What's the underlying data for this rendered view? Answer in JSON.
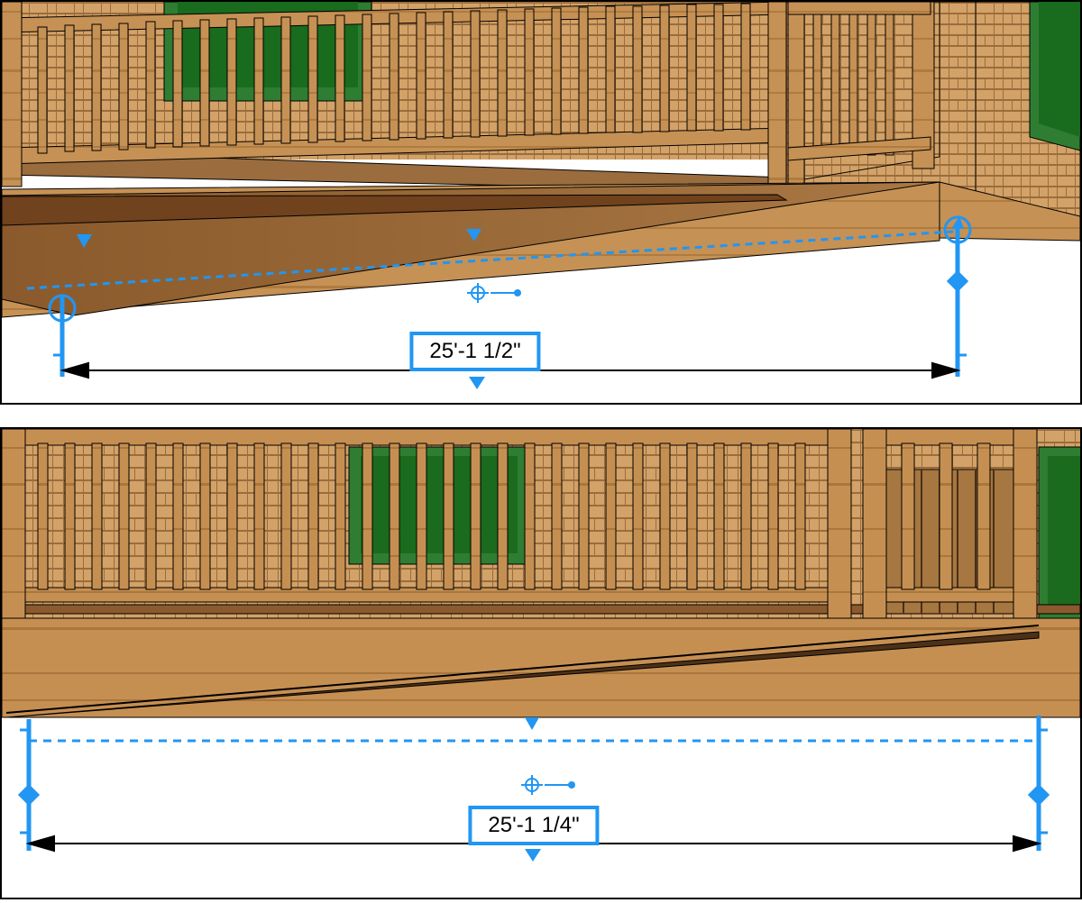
{
  "panels": [
    {
      "id": "top",
      "dimension_text": "25'-1 1/2\"",
      "dimension_label_x": 525,
      "dimension_label_y": 388,
      "selection_color": "#2196f3",
      "arrow_color": "#000"
    },
    {
      "id": "bottom",
      "dimension_text": "25'-1 1/4\"",
      "dimension_label_x": 590,
      "dimension_label_y": 440,
      "selection_color": "#2196f3",
      "arrow_color": "#000"
    }
  ]
}
